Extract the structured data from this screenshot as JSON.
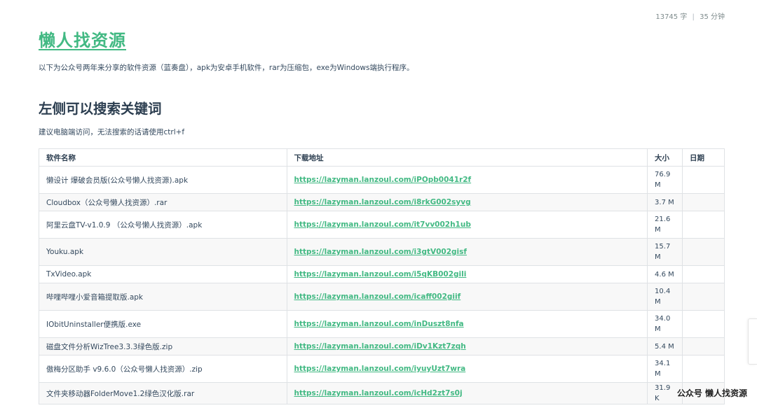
{
  "meta": {
    "words": "13745 字",
    "separator": "|",
    "read_time": "35 分钟"
  },
  "title": "懒人找资源",
  "intro": "以下为公众号两年来分享的软件资源（蓝奏盘），apk为安卓手机软件，rar为压缩包，exe为Windows端执行程序。",
  "section_heading": "左侧可以搜索关键词",
  "hint": "建议电脑端访问，无法搜索的话请使用ctrl+f",
  "table": {
    "headers": [
      "软件名称",
      "下载地址",
      "大小",
      "日期"
    ],
    "rows": [
      {
        "name": "懒设计 爆破会员版(公众号懒人找资源).apk",
        "url": "https://lazyman.lanzoul.com/iPOpb0041r2f",
        "size": "76.9 M",
        "date": ""
      },
      {
        "name": "Cloudbox（公众号懒人找资源）.rar",
        "url": "https://lazyman.lanzoul.com/i8rkG002syvg",
        "size": "3.7 M",
        "date": ""
      },
      {
        "name": "阿里云盘TV-v1.0.9 （公众号懒人找资源）.apk",
        "url": "https://lazyman.lanzoul.com/it7vv002h1ub",
        "size": "21.6 M",
        "date": ""
      },
      {
        "name": "Youku.apk",
        "url": "https://lazyman.lanzoul.com/i3gtV002gisf",
        "size": "15.7 M",
        "date": ""
      },
      {
        "name": "TxVideo.apk",
        "url": "https://lazyman.lanzoul.com/i5qKB002gili",
        "size": "4.6 M",
        "date": ""
      },
      {
        "name": "哔哩哔哩小爱音箱提取版.apk",
        "url": "https://lazyman.lanzoul.com/icaff002giif",
        "size": "10.4 M",
        "date": ""
      },
      {
        "name": "IObitUninstaller便携版.exe",
        "url": "https://lazyman.lanzoul.com/inDuszt8nfa",
        "size": "34.0 M",
        "date": ""
      },
      {
        "name": "磁盘文件分析WizTree3.3.3绿色版.zip",
        "url": "https://lazyman.lanzoul.com/iDv1Kzt7zqh",
        "size": "5.4 M",
        "date": ""
      },
      {
        "name": "傲梅分区助手 v9.6.0（公众号懒人找资源）.zip",
        "url": "https://lazyman.lanzoul.com/iyuyUzt7wra",
        "size": "34.1 M",
        "date": ""
      },
      {
        "name": "文件夹移动器FolderMove1.2绿色汉化版.rar",
        "url": "https://lazyman.lanzoul.com/icHd2zt7s0j",
        "size": "31.9 K",
        "date": ""
      }
    ]
  },
  "watermark": "公众号 懒人找资源",
  "colors": {
    "accent": "#42b983",
    "text": "#34495e",
    "heading": "#2c3e50",
    "border": "#dfe2e5"
  }
}
